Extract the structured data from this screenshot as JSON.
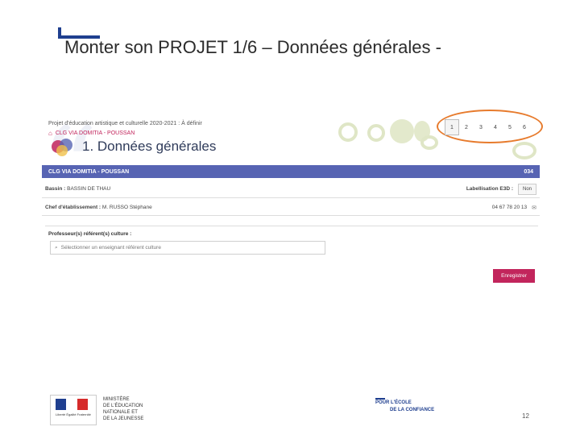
{
  "slide": {
    "title": "Monter son PROJET 1/6 – Données générales -",
    "page_number": "12"
  },
  "app": {
    "breadcrumb": "Projet d'éducation artistique et culturelle 2020-2021 : À définir",
    "school_link": "CLG VIA DOMITIA - POUSSAN",
    "section_title": "1. Données générales",
    "steps": [
      "1",
      "2",
      "3",
      "4",
      "5",
      "6"
    ],
    "active_step": "1",
    "banner": {
      "name": "CLG VIA DOMITIA - POUSSAN",
      "code": "034"
    },
    "bassin": {
      "label": "Bassin :",
      "value": "BASSIN DE THAU"
    },
    "labellisation": {
      "label": "Labellisation E3D :",
      "value": "Non"
    },
    "chef": {
      "label": "Chef d'établissement :",
      "value": "M. RUSSO Stéphane"
    },
    "phone": "04 67 78 20 13",
    "professeur": {
      "label": "Professeur(s) référent(s) culture :",
      "placeholder": "Sélectionner un enseignant référent culture"
    },
    "save_label": "Enregistrer"
  },
  "footer": {
    "ministry_lines": "MINISTÈRE\nDE L'ÉDUCATION\nNATIONALE ET\nDE LA JEUNESSE",
    "motto": "Liberté Égalité Fraternité",
    "confiance_line1": "POUR L'ÉCOLE",
    "confiance_line2": "DE LA CONFIANCE"
  },
  "colors": {
    "banner": "#5764b3",
    "accent": "#c2255c",
    "step_highlight": "#e77b2d",
    "slide_accent": "#1f3f8f"
  }
}
